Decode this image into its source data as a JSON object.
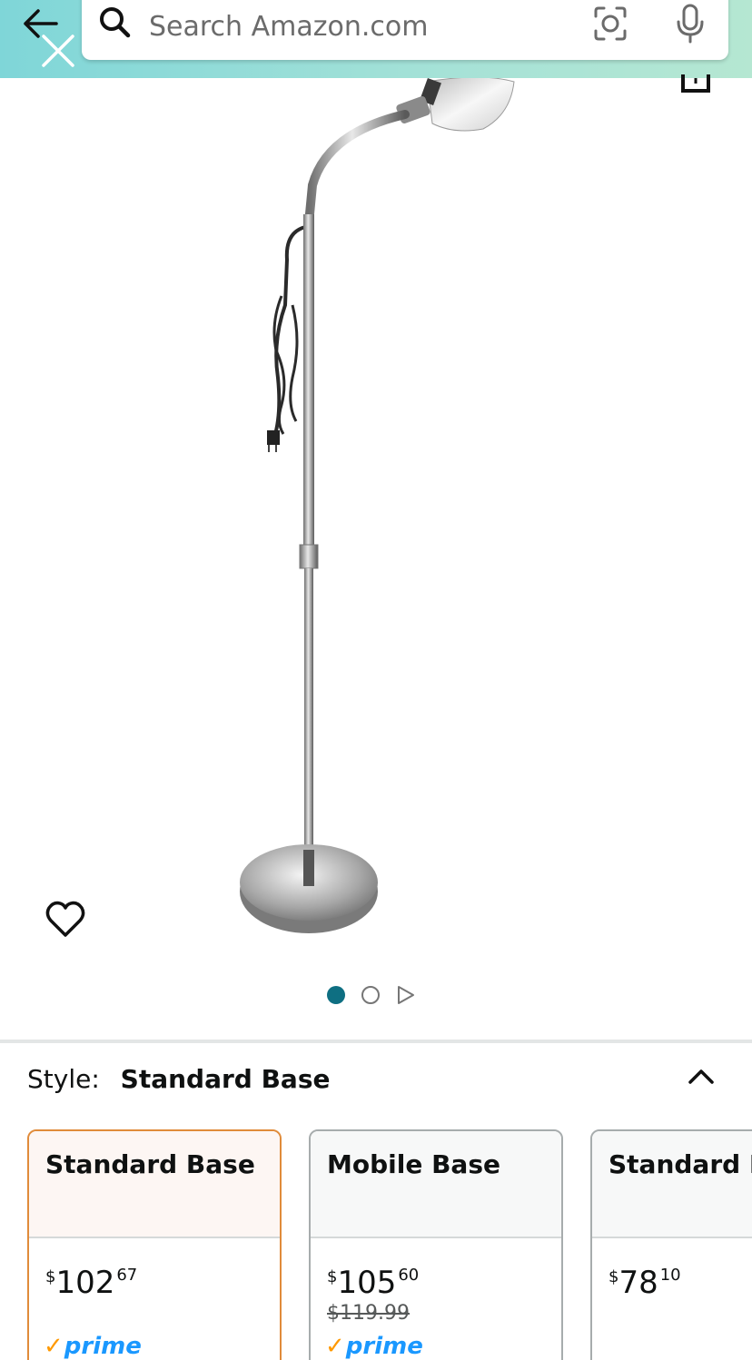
{
  "search": {
    "placeholder": "Search Amazon.com"
  },
  "style_selector": {
    "label": "Style:",
    "selected": "Standard Base"
  },
  "variants": [
    {
      "name": "Standard Base",
      "price_symbol": "$",
      "price_whole": "102",
      "price_cents": "67",
      "list_price": "",
      "prime": "prime"
    },
    {
      "name": "Mobile Base",
      "price_symbol": "$",
      "price_whole": "105",
      "price_cents": "60",
      "list_price": "$119.99",
      "prime": "prime"
    },
    {
      "name": "Standard B",
      "price_symbol": "$",
      "price_whole": "78",
      "price_cents": "10",
      "list_price": "",
      "prime": ""
    }
  ],
  "carousel": {
    "total_images": 2,
    "active_index": 0
  },
  "icons": {
    "back": "arrow-left-icon",
    "close": "close-icon",
    "search": "search-icon",
    "camera": "camera-lens-icon",
    "mic": "microphone-icon",
    "share": "share-icon",
    "wishlist": "heart-icon",
    "collapse": "chevron-up-icon",
    "next": "play-triangle-icon"
  },
  "colors": {
    "header_start": "#7fd6d8",
    "header_end": "#b5e7d2",
    "active_dot": "#0e6f82",
    "selected_border": "#e08b3a",
    "prime_blue": "#1a98ff",
    "prime_check": "#ff9900"
  }
}
